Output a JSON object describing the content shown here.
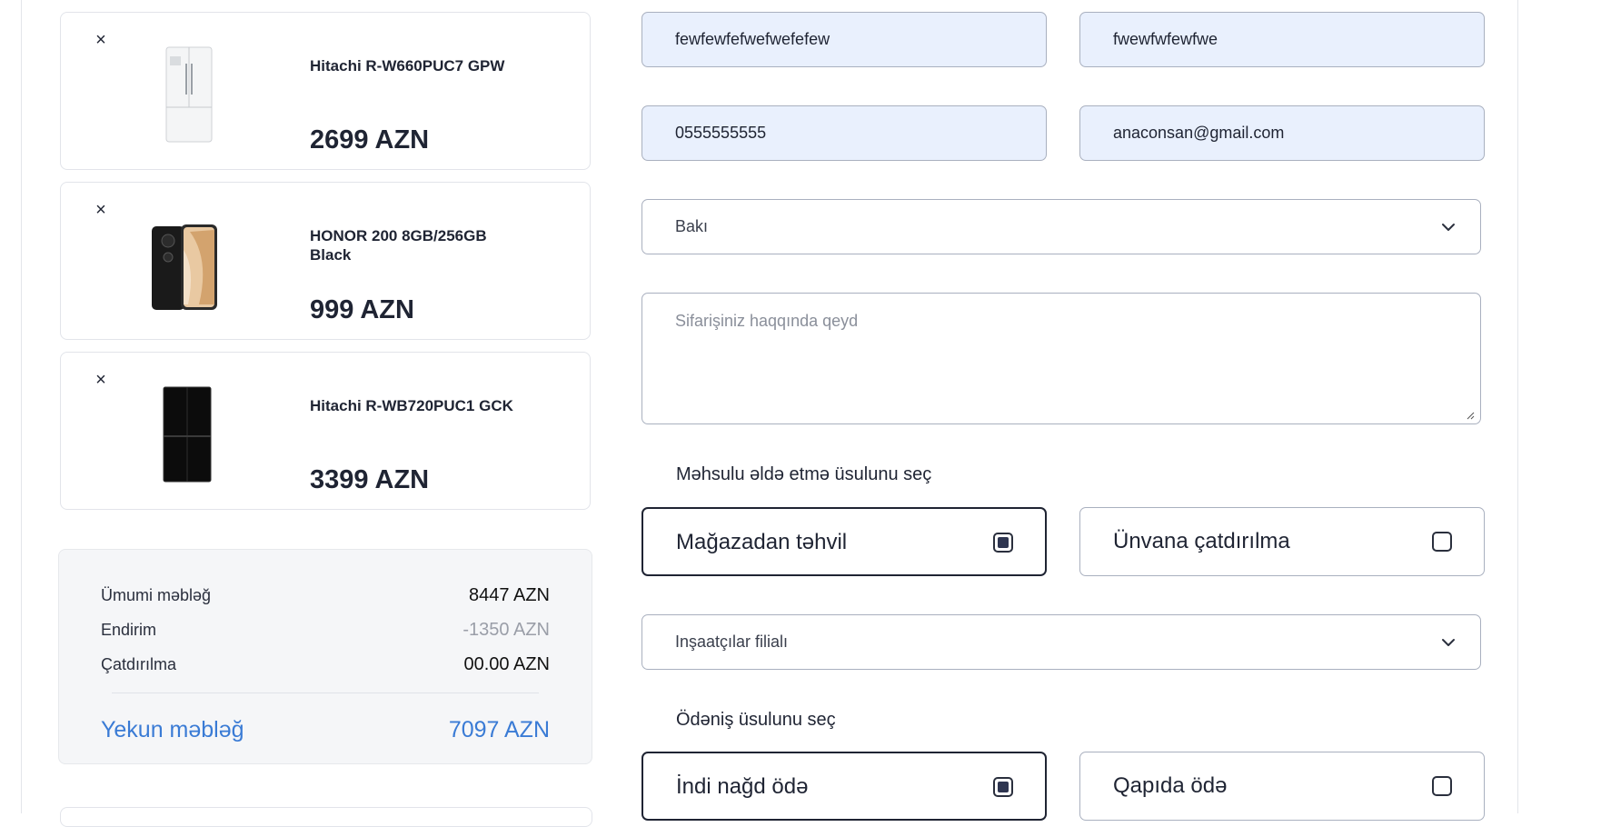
{
  "cart": {
    "items": [
      {
        "name": "Hitachi R-W660PUC7 GPW",
        "price": "2699 AZN",
        "image": "white-refrigerator-image"
      },
      {
        "name": "HONOR 200 8GB/256GB Black",
        "price": "999 AZN",
        "image": "black-smartphone-image"
      },
      {
        "name": "Hitachi R-WB720PUC1 GCK",
        "price": "3399 AZN",
        "image": "black-refrigerator-image"
      }
    ],
    "remove_icon": "close-icon"
  },
  "summary": {
    "subtotal_label": "Ümumi məbləğ",
    "subtotal_value": "8447 AZN",
    "discount_label": "Endirim",
    "discount_value": "-1350 AZN",
    "shipping_label": "Çatdırılma",
    "shipping_value": "00.00 AZN",
    "total_label": "Yekun məbləğ",
    "total_value": "7097 AZN",
    "total_color": "#3a7bd5"
  },
  "form": {
    "first_name": "fewfewfefwefwefefew",
    "last_name": "fwewfwfewfwe",
    "phone": "0555555555",
    "email": "anaconsan@gmail.com",
    "city": "Bakı",
    "note_placeholder": "Sifarişiniz haqqında qeyd",
    "delivery_title": "Məhsulu əldə etmə üsulunu seç",
    "delivery_options": [
      {
        "label": "Mağazadan təhvil",
        "checked": true
      },
      {
        "label": "Ünvana çatdırılma",
        "checked": false
      }
    ],
    "branch": "Inşaatçılar filialı",
    "payment_title": "Ödəniş üsulunu seç",
    "payment_options": [
      {
        "label": "İndi nağd ödə",
        "checked": true
      },
      {
        "label": "Qapıda ödə",
        "checked": false
      }
    ],
    "input_fill_color": "#e9f0fd"
  }
}
